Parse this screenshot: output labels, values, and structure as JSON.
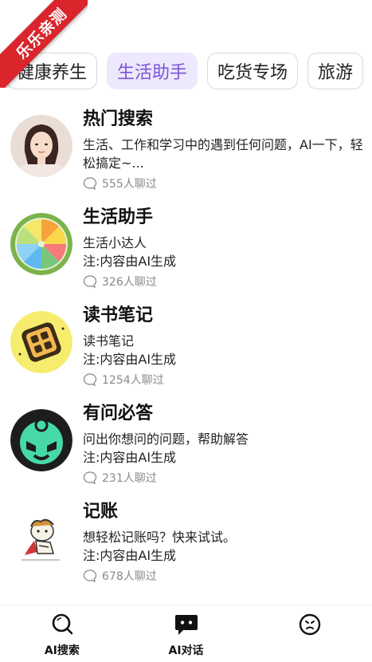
{
  "ribbon": {
    "text": "乐乐亲测"
  },
  "tabs": [
    {
      "label": "健康养生",
      "active": false
    },
    {
      "label": "生活助手",
      "active": true
    },
    {
      "label": "吃货专场",
      "active": false
    },
    {
      "label": "旅游",
      "active": false
    }
  ],
  "items": [
    {
      "title": "热门搜索",
      "desc": "生活、工作和学习中的遇到任何问题，AI一下，轻松搞定~...",
      "count": "555人聊过",
      "avatar_icon": "woman-portrait"
    },
    {
      "title": "生活助手",
      "desc": "生活小达人\n注:内容由AI生成",
      "desc1": "生活小达人",
      "desc2": "注:内容由AI生成",
      "count": "326人聊过",
      "avatar_icon": "lemon-slice"
    },
    {
      "title": "读书笔记",
      "desc1": "读书笔记",
      "desc2": "注:内容由AI生成",
      "count": "1254人聊过",
      "avatar_icon": "book-emblem"
    },
    {
      "title": "有问必答",
      "desc1": "问出你想问的问题，帮助解答",
      "desc2": "注:内容由AI生成",
      "count": "231人聊过",
      "avatar_icon": "smile-face"
    },
    {
      "title": "记账",
      "desc1": "想轻松记账吗？快来试试。",
      "desc2": "注:内容由AI生成",
      "count": "678人聊过",
      "avatar_icon": "cartoon-character"
    }
  ],
  "nav": [
    {
      "label": "AI搜索",
      "icon": "search-icon"
    },
    {
      "label": "AI对话",
      "icon": "chat-icon"
    },
    {
      "label": "",
      "icon": "face-icon"
    }
  ],
  "colors": {
    "accent": "#7a55d8",
    "tab_active_bg": "#ede8fb",
    "ribbon": "#d9252b"
  }
}
